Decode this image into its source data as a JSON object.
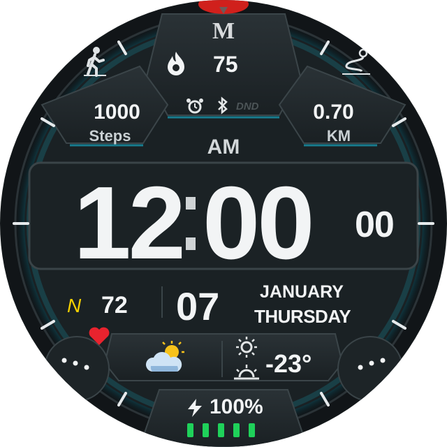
{
  "top": {
    "brand": "M",
    "heart_rate": "75",
    "steps_value": "1000",
    "steps_label": "Steps",
    "distance_value": "0.70",
    "distance_label": "KM",
    "dnd": "DND"
  },
  "time": {
    "ampm": "AM",
    "hours": "12",
    "minutes": "00",
    "seconds": "00"
  },
  "info": {
    "compass": "N",
    "compass_value": "72",
    "day": "07",
    "month": "JANUARY",
    "weekday": "THURSDAY"
  },
  "weather": {
    "temperature": "-23°"
  },
  "battery": {
    "percent_label": "100%",
    "level": 1.0,
    "bars": 5
  },
  "colors": {
    "accent": "#18c7e6",
    "compass": "#f5d000",
    "heart": "#e8232e",
    "battery": "#1fd15a",
    "top_marker": "#d0201c"
  },
  "icons": [
    "walk-icon",
    "flame-icon",
    "route-icon",
    "alarm-icon",
    "bluetooth-icon",
    "heart-icon",
    "weather-icon",
    "sunrise-icon",
    "sunset-icon",
    "bolt-icon"
  ]
}
